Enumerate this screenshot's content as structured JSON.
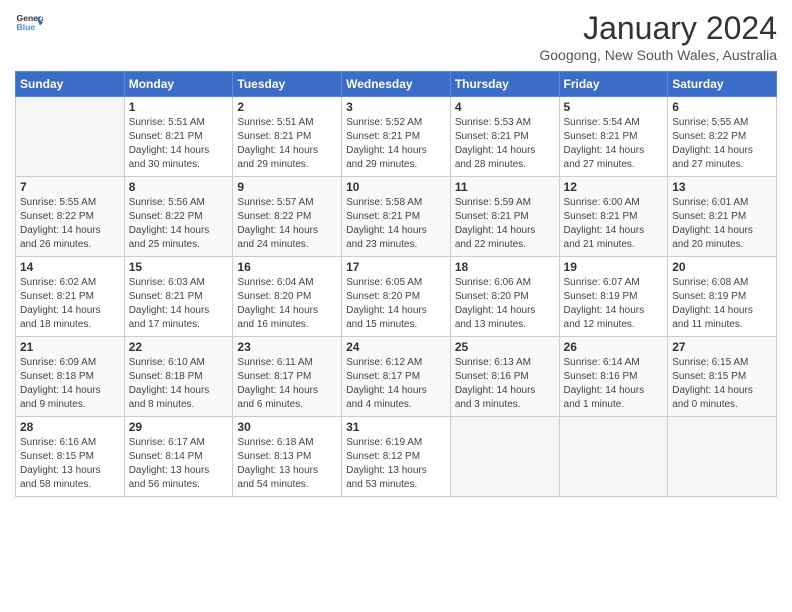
{
  "header": {
    "logo_text_general": "General",
    "logo_text_blue": "Blue",
    "month_year": "January 2024",
    "location": "Googong, New South Wales, Australia"
  },
  "weekdays": [
    "Sunday",
    "Monday",
    "Tuesday",
    "Wednesday",
    "Thursday",
    "Friday",
    "Saturday"
  ],
  "weeks": [
    [
      {
        "day": "",
        "info": ""
      },
      {
        "day": "1",
        "info": "Sunrise: 5:51 AM\nSunset: 8:21 PM\nDaylight: 14 hours\nand 30 minutes."
      },
      {
        "day": "2",
        "info": "Sunrise: 5:51 AM\nSunset: 8:21 PM\nDaylight: 14 hours\nand 29 minutes."
      },
      {
        "day": "3",
        "info": "Sunrise: 5:52 AM\nSunset: 8:21 PM\nDaylight: 14 hours\nand 29 minutes."
      },
      {
        "day": "4",
        "info": "Sunrise: 5:53 AM\nSunset: 8:21 PM\nDaylight: 14 hours\nand 28 minutes."
      },
      {
        "day": "5",
        "info": "Sunrise: 5:54 AM\nSunset: 8:21 PM\nDaylight: 14 hours\nand 27 minutes."
      },
      {
        "day": "6",
        "info": "Sunrise: 5:55 AM\nSunset: 8:22 PM\nDaylight: 14 hours\nand 27 minutes."
      }
    ],
    [
      {
        "day": "7",
        "info": "Sunrise: 5:55 AM\nSunset: 8:22 PM\nDaylight: 14 hours\nand 26 minutes."
      },
      {
        "day": "8",
        "info": "Sunrise: 5:56 AM\nSunset: 8:22 PM\nDaylight: 14 hours\nand 25 minutes."
      },
      {
        "day": "9",
        "info": "Sunrise: 5:57 AM\nSunset: 8:22 PM\nDaylight: 14 hours\nand 24 minutes."
      },
      {
        "day": "10",
        "info": "Sunrise: 5:58 AM\nSunset: 8:21 PM\nDaylight: 14 hours\nand 23 minutes."
      },
      {
        "day": "11",
        "info": "Sunrise: 5:59 AM\nSunset: 8:21 PM\nDaylight: 14 hours\nand 22 minutes."
      },
      {
        "day": "12",
        "info": "Sunrise: 6:00 AM\nSunset: 8:21 PM\nDaylight: 14 hours\nand 21 minutes."
      },
      {
        "day": "13",
        "info": "Sunrise: 6:01 AM\nSunset: 8:21 PM\nDaylight: 14 hours\nand 20 minutes."
      }
    ],
    [
      {
        "day": "14",
        "info": "Sunrise: 6:02 AM\nSunset: 8:21 PM\nDaylight: 14 hours\nand 18 minutes."
      },
      {
        "day": "15",
        "info": "Sunrise: 6:03 AM\nSunset: 8:21 PM\nDaylight: 14 hours\nand 17 minutes."
      },
      {
        "day": "16",
        "info": "Sunrise: 6:04 AM\nSunset: 8:20 PM\nDaylight: 14 hours\nand 16 minutes."
      },
      {
        "day": "17",
        "info": "Sunrise: 6:05 AM\nSunset: 8:20 PM\nDaylight: 14 hours\nand 15 minutes."
      },
      {
        "day": "18",
        "info": "Sunrise: 6:06 AM\nSunset: 8:20 PM\nDaylight: 14 hours\nand 13 minutes."
      },
      {
        "day": "19",
        "info": "Sunrise: 6:07 AM\nSunset: 8:19 PM\nDaylight: 14 hours\nand 12 minutes."
      },
      {
        "day": "20",
        "info": "Sunrise: 6:08 AM\nSunset: 8:19 PM\nDaylight: 14 hours\nand 11 minutes."
      }
    ],
    [
      {
        "day": "21",
        "info": "Sunrise: 6:09 AM\nSunset: 8:18 PM\nDaylight: 14 hours\nand 9 minutes."
      },
      {
        "day": "22",
        "info": "Sunrise: 6:10 AM\nSunset: 8:18 PM\nDaylight: 14 hours\nand 8 minutes."
      },
      {
        "day": "23",
        "info": "Sunrise: 6:11 AM\nSunset: 8:17 PM\nDaylight: 14 hours\nand 6 minutes."
      },
      {
        "day": "24",
        "info": "Sunrise: 6:12 AM\nSunset: 8:17 PM\nDaylight: 14 hours\nand 4 minutes."
      },
      {
        "day": "25",
        "info": "Sunrise: 6:13 AM\nSunset: 8:16 PM\nDaylight: 14 hours\nand 3 minutes."
      },
      {
        "day": "26",
        "info": "Sunrise: 6:14 AM\nSunset: 8:16 PM\nDaylight: 14 hours\nand 1 minute."
      },
      {
        "day": "27",
        "info": "Sunrise: 6:15 AM\nSunset: 8:15 PM\nDaylight: 14 hours\nand 0 minutes."
      }
    ],
    [
      {
        "day": "28",
        "info": "Sunrise: 6:16 AM\nSunset: 8:15 PM\nDaylight: 13 hours\nand 58 minutes."
      },
      {
        "day": "29",
        "info": "Sunrise: 6:17 AM\nSunset: 8:14 PM\nDaylight: 13 hours\nand 56 minutes."
      },
      {
        "day": "30",
        "info": "Sunrise: 6:18 AM\nSunset: 8:13 PM\nDaylight: 13 hours\nand 54 minutes."
      },
      {
        "day": "31",
        "info": "Sunrise: 6:19 AM\nSunset: 8:12 PM\nDaylight: 13 hours\nand 53 minutes."
      },
      {
        "day": "",
        "info": ""
      },
      {
        "day": "",
        "info": ""
      },
      {
        "day": "",
        "info": ""
      }
    ]
  ]
}
